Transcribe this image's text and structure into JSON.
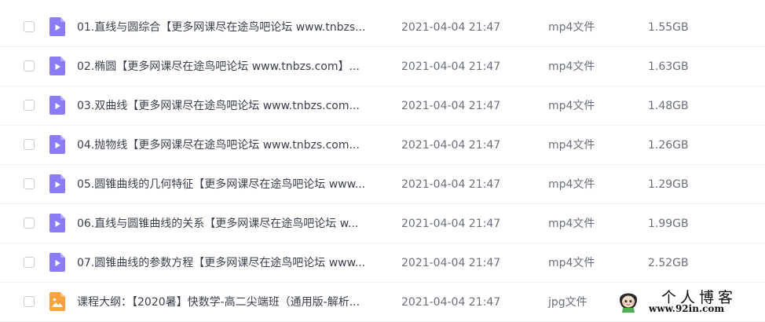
{
  "files": [
    {
      "name": "01.直线与圆综合【更多网课尽在途鸟吧论坛 www.tnbzs...",
      "date": "2021-04-04 21:47",
      "type": "mp4文件",
      "size": "1.55GB",
      "icon": "video-file-icon"
    },
    {
      "name": "02.椭圆【更多网课尽在途鸟吧论坛 www.tnbzs.com】...",
      "date": "2021-04-04 21:47",
      "type": "mp4文件",
      "size": "1.63GB",
      "icon": "video-file-icon"
    },
    {
      "name": "03.双曲线【更多网课尽在途鸟吧论坛 www.tnbzs.com...",
      "date": "2021-04-04 21:47",
      "type": "mp4文件",
      "size": "1.48GB",
      "icon": "video-file-icon"
    },
    {
      "name": "04.抛物线【更多网课尽在途鸟吧论坛 www.tnbzs.com...",
      "date": "2021-04-04 21:47",
      "type": "mp4文件",
      "size": "1.26GB",
      "icon": "video-file-icon"
    },
    {
      "name": "05.圆锥曲线的几何特征【更多网课尽在途鸟吧论坛 www...",
      "date": "2021-04-04 21:47",
      "type": "mp4文件",
      "size": "1.29GB",
      "icon": "video-file-icon"
    },
    {
      "name": "06.直线与圆锥曲线的关系【更多网课尽在途鸟吧论坛 w...",
      "date": "2021-04-04 21:47",
      "type": "mp4文件",
      "size": "1.99GB",
      "icon": "video-file-icon"
    },
    {
      "name": "07.圆锥曲线的参数方程【更多网课尽在途鸟吧论坛 www...",
      "date": "2021-04-04 21:47",
      "type": "mp4文件",
      "size": "2.52GB",
      "icon": "video-file-icon"
    },
    {
      "name": "课程大纲：【2020暑】快数学-高二尖端班（通用版-解析...",
      "date": "2021-04-04 21:47",
      "type": "jpg文件",
      "size": "",
      "icon": "image-file-icon"
    }
  ],
  "watermark": {
    "title": "个人博客",
    "url": "www.92in.com"
  },
  "colors": {
    "video_icon": "#8b7cf6",
    "image_icon": "#f7a23b",
    "checkbox_border": "#c9ccd3",
    "text_primary": "#3a3f4b",
    "text_secondary": "#6a6f7a"
  }
}
